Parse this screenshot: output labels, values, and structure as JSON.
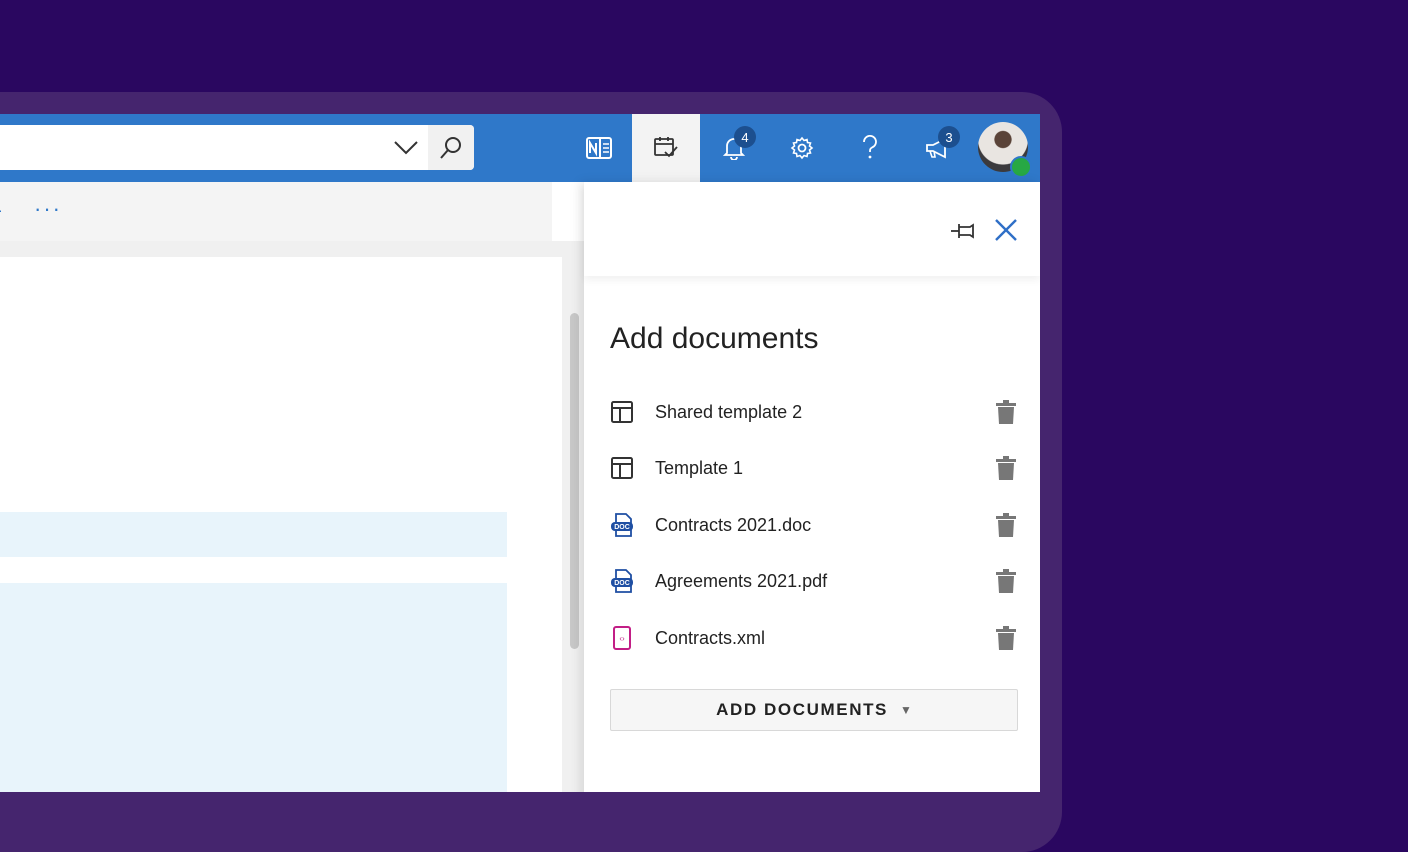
{
  "topbar": {
    "notifications_count": "4",
    "announcements_count": "3"
  },
  "panel": {
    "title": "Add documents",
    "documents": [
      {
        "name": "Shared template 2",
        "icon": "template-icon"
      },
      {
        "name": "Template 1",
        "icon": "template-icon"
      },
      {
        "name": "Contracts 2021.doc",
        "icon": "doc-file-icon"
      },
      {
        "name": "Agreements 2021.pdf",
        "icon": "doc-file-icon"
      },
      {
        "name": "Contracts.xml",
        "icon": "xml-file-icon"
      }
    ],
    "add_button_label": "ADD DOCUMENTS"
  },
  "ribbon": {
    "more_label": "···"
  },
  "colors": {
    "background": "#2a0760",
    "frame": "#45256e",
    "topbar": "#2f78c9",
    "badge": "#1c4f8f",
    "presence": "#27a844",
    "highlight": "#e8f4fb",
    "xml_icon": "#c21e86",
    "doc_icon": "#1f4fa3"
  }
}
